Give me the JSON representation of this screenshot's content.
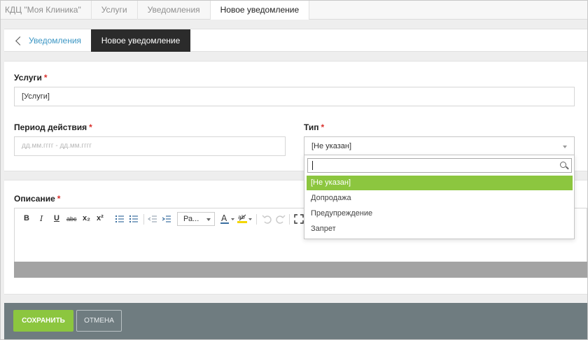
{
  "topbar": {
    "crumbs": [
      "КДЦ \"Моя Клиника\"",
      "Услуги",
      "Уведомления",
      "Новое уведомление"
    ]
  },
  "subbar": {
    "back_label": "Уведомления",
    "active_label": "Новое уведомление"
  },
  "form": {
    "services": {
      "label": "Услуги",
      "required": "*",
      "value": "[Услуги]"
    },
    "period": {
      "label": "Период действия",
      "required": "*",
      "placeholder": "дд.мм.гггг - дд.мм.гггг"
    },
    "type": {
      "label": "Тип",
      "required": "*",
      "value": "[Не указан]"
    },
    "description": {
      "label": "Описание",
      "required": "*"
    }
  },
  "type_dropdown": {
    "search_value": "",
    "options": [
      "[Не указан]",
      "Допродажа",
      "Предупреждение",
      "Запрет"
    ],
    "selected_index": 0
  },
  "editor_toolbar": {
    "bold": "B",
    "italic": "I",
    "underline": "U",
    "strike": "abc",
    "subscript": "x₂",
    "superscript": "x²",
    "paragraph_select": "Ра..."
  },
  "footer": {
    "save_label": "СОХРАНИТЬ",
    "cancel_label": "ОТМЕНА"
  },
  "colors": {
    "accent_green": "#8cc63f",
    "link_blue": "#3b96c4",
    "footer_gray": "#6f7c80",
    "dark_tab": "#2b2b2b",
    "required_red": "#d9302c"
  }
}
